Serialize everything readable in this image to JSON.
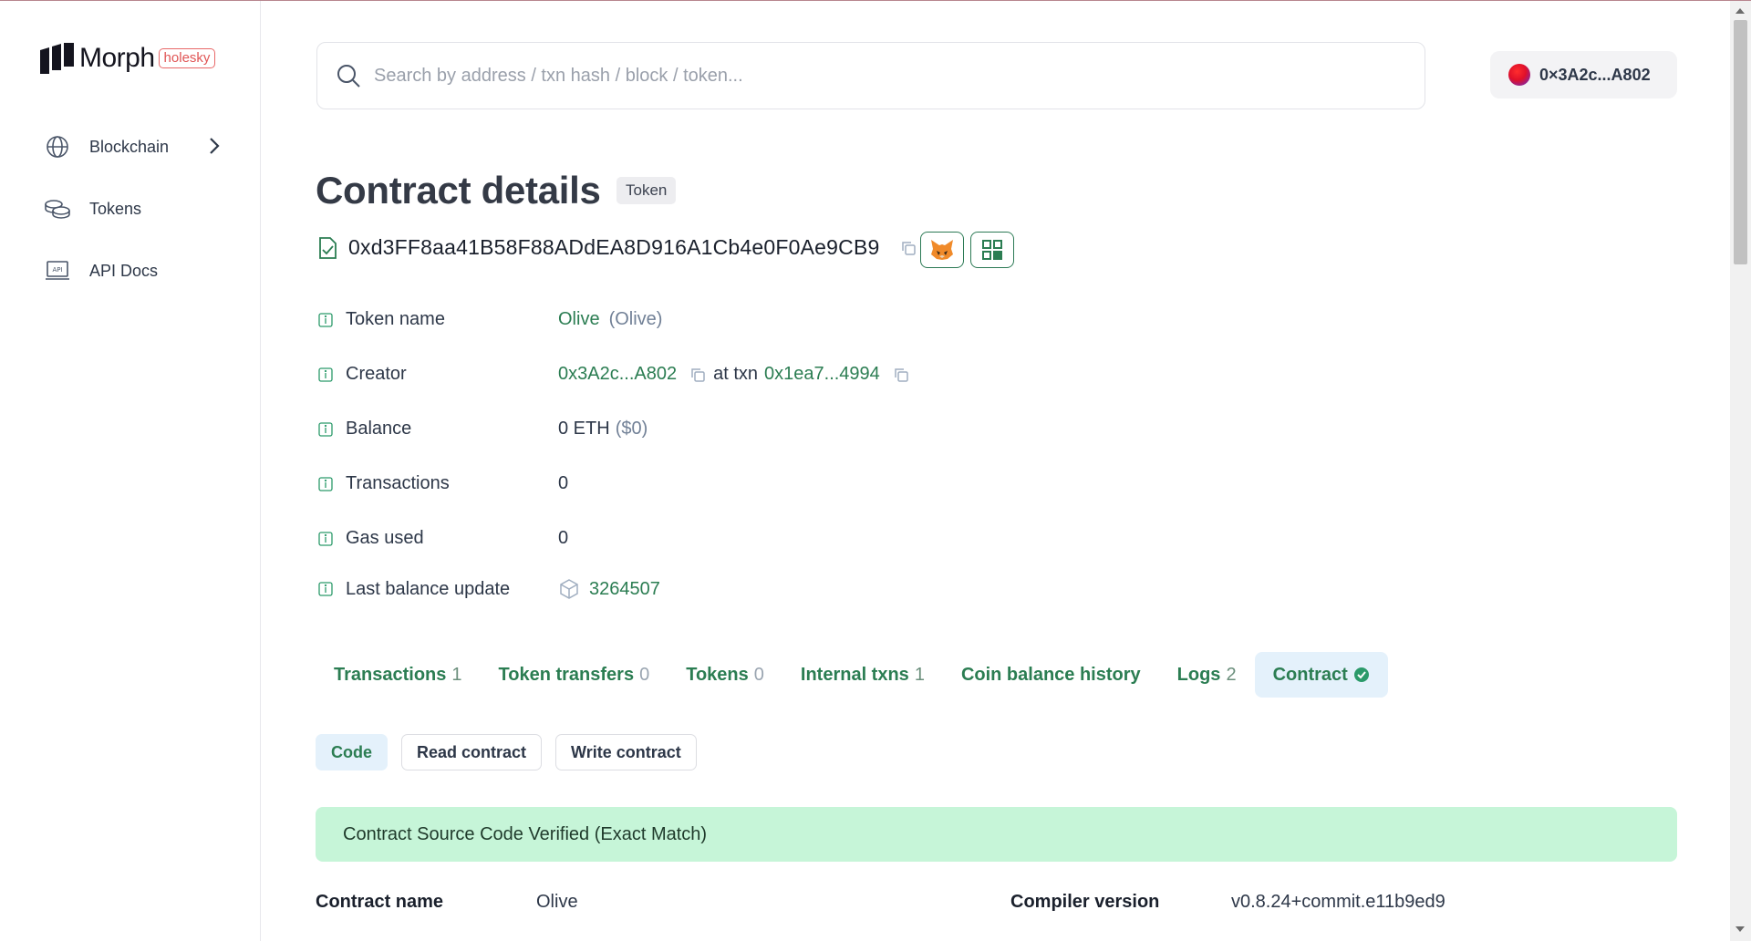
{
  "sidebar": {
    "logo_text": "Morph",
    "network_badge": "holesky",
    "items": [
      {
        "label": "Blockchain",
        "icon": "globe-icon"
      },
      {
        "label": "Tokens",
        "icon": "coins-icon"
      },
      {
        "label": "API Docs",
        "icon": "api-icon"
      }
    ]
  },
  "header": {
    "search_placeholder": "Search by address / txn hash / block / token...",
    "account_address": "0×3A2c...A802"
  },
  "page": {
    "title": "Contract details",
    "type_tag": "Token",
    "contract_address": "0xd3FF8aa41B58F88ADdEA8D916A1Cb4e0F0Ae9CB9"
  },
  "details": {
    "token_name": {
      "label": "Token name",
      "name": "Olive",
      "symbol": "(Olive)"
    },
    "creator": {
      "label": "Creator",
      "address": "0x3A2c...A802",
      "at_txn": "at txn",
      "txn": "0x1ea7...4994"
    },
    "balance": {
      "label": "Balance",
      "value": "0 ETH",
      "usd": "($0)"
    },
    "transactions": {
      "label": "Transactions",
      "value": "0"
    },
    "gas_used": {
      "label": "Gas used",
      "value": "0"
    },
    "last_balance_update": {
      "label": "Last balance update",
      "value": "3264507"
    }
  },
  "tabs": [
    {
      "label": "Transactions",
      "count": "1"
    },
    {
      "label": "Token transfers",
      "count": "0"
    },
    {
      "label": "Tokens",
      "count": "0"
    },
    {
      "label": "Internal txns",
      "count": "1"
    },
    {
      "label": "Coin balance history",
      "count": ""
    },
    {
      "label": "Logs",
      "count": "2"
    },
    {
      "label": "Contract",
      "count": ""
    }
  ],
  "active_tab": "Contract",
  "subtabs": [
    "Code",
    "Read contract",
    "Write contract"
  ],
  "active_subtab": "Code",
  "verified_banner": "Contract Source Code Verified (Exact Match)",
  "contract_info": {
    "name_label": "Contract name",
    "name_value": "Olive",
    "compiler_label": "Compiler version",
    "compiler_value": "v0.8.24+commit.e11b9ed9"
  },
  "colors": {
    "accent_green": "#2b7d52",
    "active_tab_bg": "#e4f1fb",
    "verified_bg": "#c6f5d8",
    "badge_red": "#e05555"
  }
}
